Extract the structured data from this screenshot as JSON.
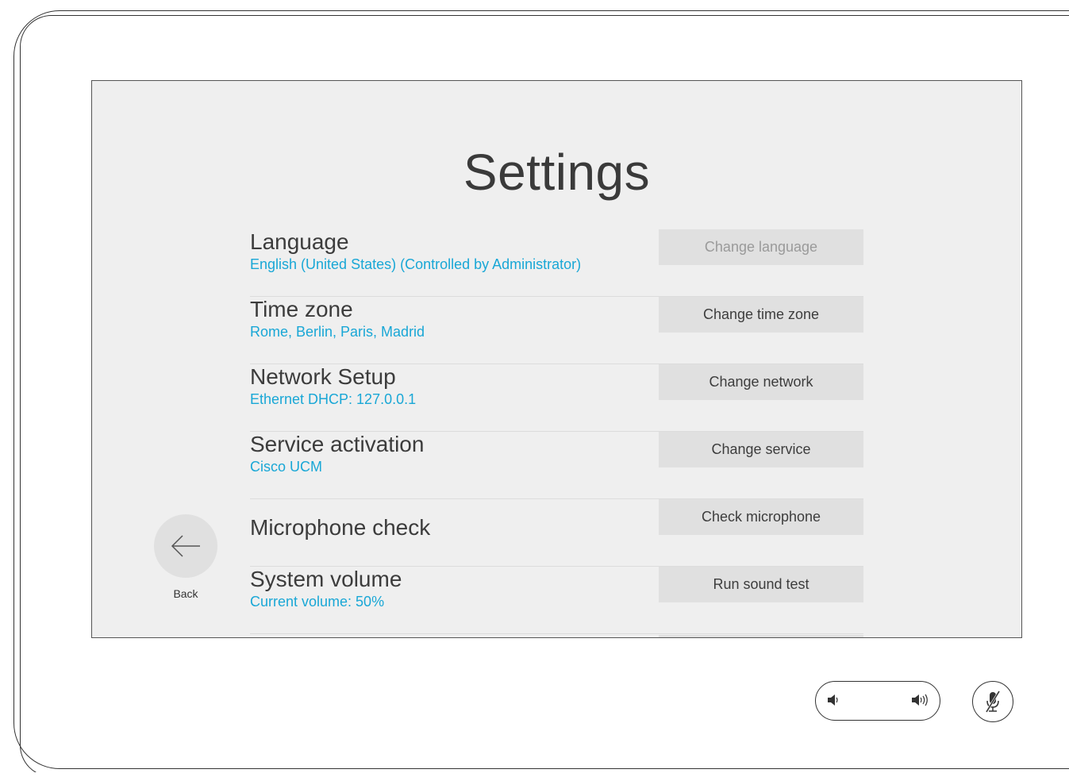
{
  "title": "Settings",
  "rows": [
    {
      "label": "Language",
      "sub": "English (United States) (Controlled by Administrator)",
      "button": "Change language",
      "button_disabled": true
    },
    {
      "label": "Time zone",
      "sub": "Rome, Berlin, Paris, Madrid",
      "button": "Change time zone"
    },
    {
      "label": "Network Setup",
      "sub": "Ethernet DHCP: 127.0.0.1",
      "button": "Change network"
    },
    {
      "label": "Service activation",
      "sub": "Cisco UCM",
      "button": "Change service"
    },
    {
      "label": "Microphone check",
      "sub": "",
      "button": "Check microphone"
    },
    {
      "label": "System volume",
      "sub": "Current volume: 50%",
      "button": "Run sound test"
    }
  ],
  "back": {
    "label": "Back",
    "icon": "arrow-left-icon"
  },
  "volume_control": {
    "down_icon": "volume-down-icon",
    "up_icon": "volume-up-icon"
  },
  "mute": {
    "icon": "microphone-muted-icon"
  },
  "colors": {
    "accent": "#19a7d6",
    "screen_bg": "#efefef",
    "button_bg": "#e0e0e0"
  }
}
